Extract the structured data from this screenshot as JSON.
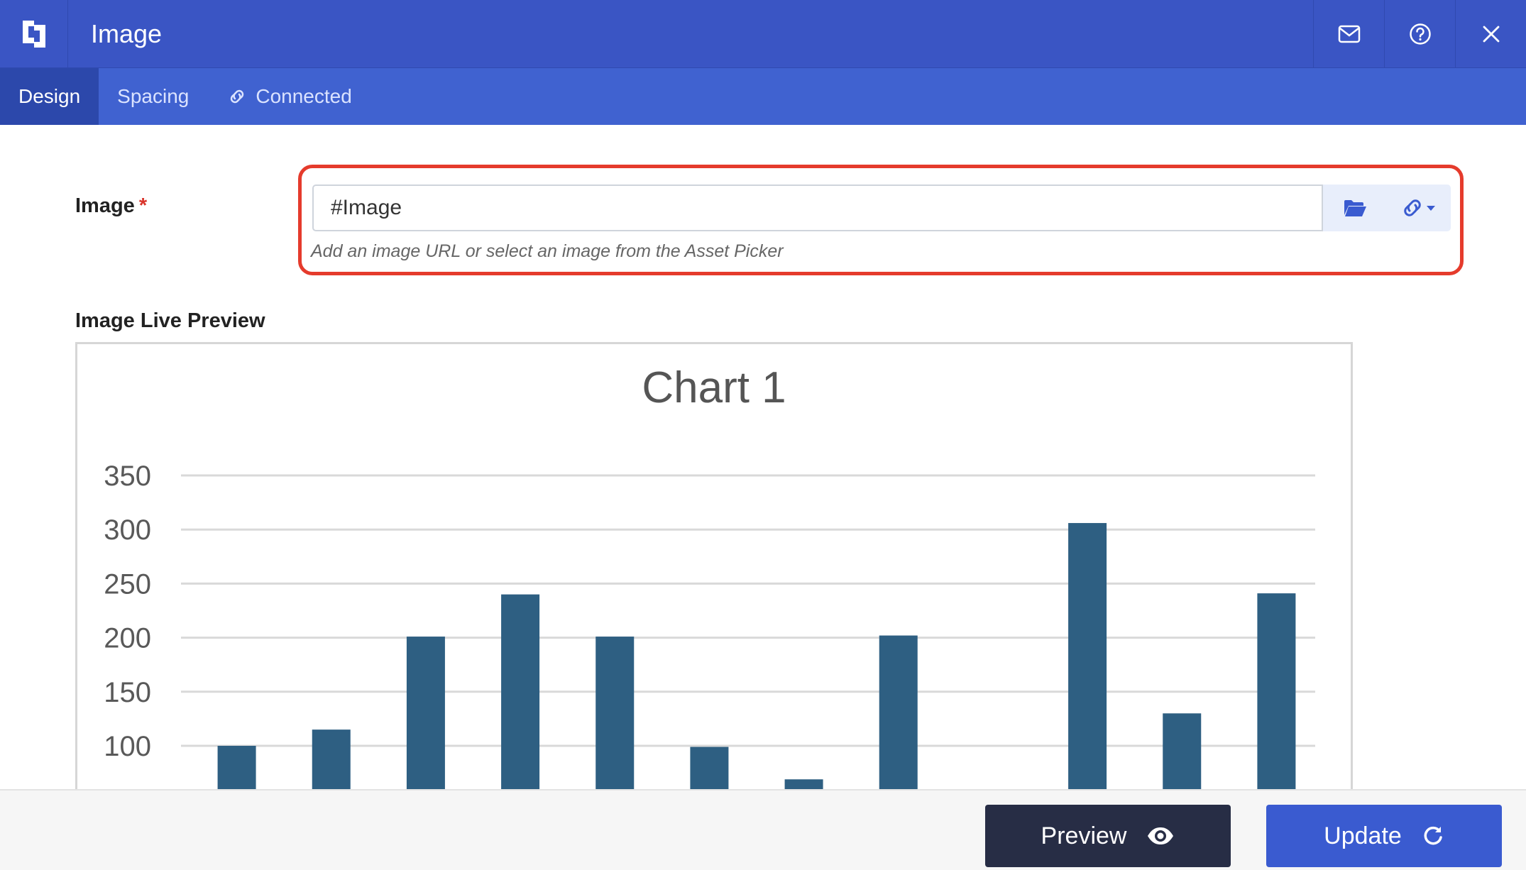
{
  "header": {
    "title": "Image"
  },
  "tabs": [
    {
      "label": "Design"
    },
    {
      "label": "Spacing"
    },
    {
      "label": "Connected"
    }
  ],
  "form": {
    "image_label": "Image",
    "required_mark": "*",
    "image_value": "#Image",
    "help_text": "Add an image URL or select an image from the Asset Picker"
  },
  "preview": {
    "label": "Image Live Preview"
  },
  "chart_data": {
    "type": "bar",
    "title": "Chart 1",
    "ylim": [
      50,
      350
    ],
    "yticks": [
      350,
      300,
      250,
      200,
      150,
      100
    ],
    "grid": true,
    "color": "#2e5f82",
    "values": [
      100,
      115,
      201,
      240,
      201,
      99,
      69,
      202,
      null,
      306,
      130,
      241
    ]
  },
  "footer": {
    "preview_label": "Preview",
    "update_label": "Update"
  },
  "colors": {
    "header": "#3a55c4",
    "tabs": "#4062d0",
    "highlight": "#e53b2c",
    "update": "#3a5bd0",
    "preview": "#272d45"
  }
}
